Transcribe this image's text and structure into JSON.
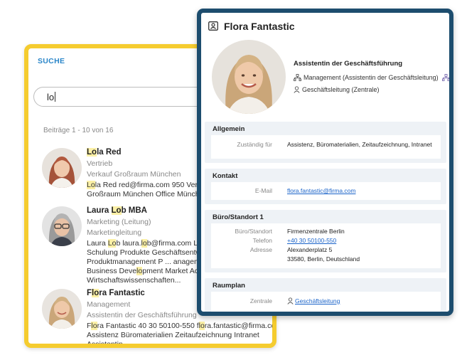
{
  "search": {
    "title": "SUCHE",
    "query": "lo",
    "count_text": "Beiträge 1 - 10 von 16",
    "results": [
      {
        "name_parts": [
          "",
          "Lo",
          "la Red"
        ],
        "line1": "Vertrieb",
        "line2": "Verkauf Großraum München",
        "snip1_parts": [
          "",
          "Lo",
          "la Red red@firma.com 950 Verkau"
        ],
        "snip2": "Großraum München Office Münchem"
      },
      {
        "name_parts": [
          "Laura ",
          "Lo",
          "b MBA"
        ],
        "line1": "Marketing (Leitung)",
        "line2": "Marketingleitung",
        "snip1_parts": [
          "Laura ",
          "Lo",
          "b laura.",
          "lo",
          "b@firma.com LL 5"
        ],
        "snip2": "Schulung Produkte Geschäftsentwick",
        "snip3": "Produktmanagement P ... anagement",
        "snip4_parts": [
          "Business Deve",
          "lo",
          "pment Market Acces"
        ],
        "snip5": "Wirtschaftswissenschaften..."
      },
      {
        "name_parts": [
          "F",
          "lo",
          "ra Fantastic"
        ],
        "line1": "Management",
        "line2": "Assistentin der Geschäftsführung",
        "snip1_parts": [
          "F",
          "lo",
          "ra Fantastic 40 30 50100-550 f",
          "lo",
          "ra.fantastic@firma.com"
        ],
        "snip2": "Assistenz Büromaterialien Zeitaufzeichnung Intranet",
        "snip3": "Assistentin..."
      }
    ]
  },
  "profile": {
    "name": "Flora Fantastic",
    "role": "Assistentin der Geschäftsführung",
    "department": "Management (Assistentin der Geschäftsleitung)",
    "org_unit": "Geschäftsleitung (Zentrale)",
    "sections": {
      "general": {
        "title": "Allgemein",
        "label": "Zuständig für",
        "value": "Assistenz, Büromaterialien, Zeitaufzeichnung, Intranet"
      },
      "contact": {
        "title": "Kontakt",
        "label": "E-Mail",
        "value": "flora.fantastic@firma.com"
      },
      "office": {
        "title": "Büro/Standort 1",
        "location_label": "Büro/Standort",
        "location": "Firmenzentrale Berlin",
        "phone_label": "Telefon",
        "phone": "+40 30 50100-550",
        "address_label": "Adresse",
        "address_line1": "Alexanderplatz 5",
        "address_line2": "33580, Berlin, Deutschland"
      },
      "room": {
        "title": "Raumplan",
        "label": "Zentrale",
        "value": "Geschäftsleitung"
      }
    }
  },
  "colors": {
    "search_border": "#f5cc2f",
    "profile_border": "#1d4d6e",
    "accent_blue": "#2a86c9",
    "highlight": "#fbf0a6",
    "link": "#1a63c9"
  },
  "icons": [
    "person-card-icon",
    "hierarchy-icon",
    "person-icon",
    "org-chart-icon",
    "location-person-icon"
  ]
}
